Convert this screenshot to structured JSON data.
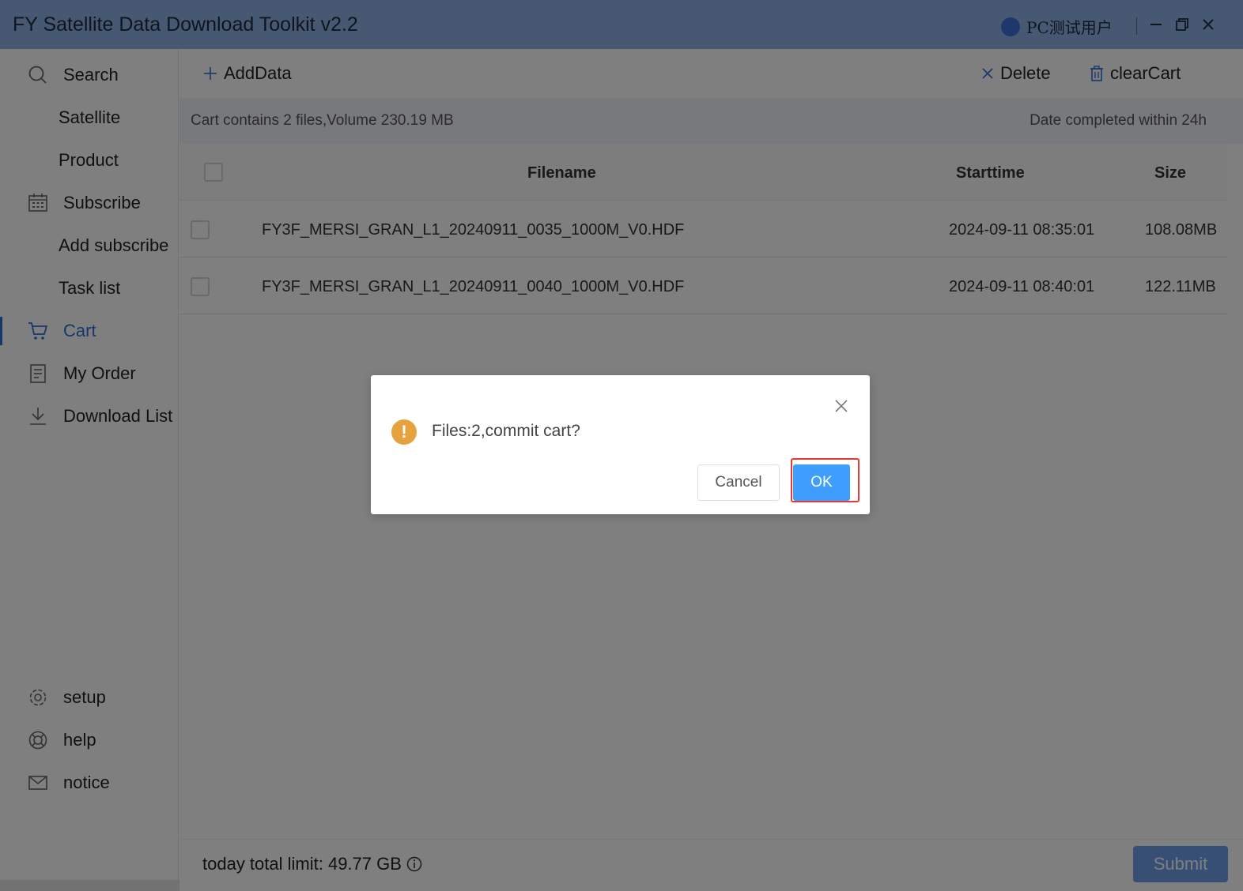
{
  "window": {
    "title": "FY Satellite Data Download Toolkit v2.2",
    "user": "PC测试用户"
  },
  "sidebar": {
    "items": [
      {
        "label": "Search",
        "icon": "search-icon"
      },
      {
        "label": "Satellite"
      },
      {
        "label": "Product"
      },
      {
        "label": "Subscribe",
        "icon": "calendar-icon"
      },
      {
        "label": "Add subscribe"
      },
      {
        "label": "Task list"
      },
      {
        "label": "Cart",
        "icon": "cart-icon",
        "active": true
      },
      {
        "label": "My Order",
        "icon": "document-icon"
      },
      {
        "label": "Download List",
        "icon": "download-icon"
      }
    ],
    "bottom_items": [
      {
        "label": "setup",
        "icon": "gear-icon"
      },
      {
        "label": "help",
        "icon": "help-icon"
      },
      {
        "label": "notice",
        "icon": "mail-icon"
      }
    ]
  },
  "toolbar": {
    "add_label": "AddData",
    "delete_label": "Delete",
    "clear_label": "clearCart"
  },
  "infobar": {
    "summary": "Cart contains 2 files,Volume 230.19 MB",
    "note": "Date completed within 24h"
  },
  "table": {
    "columns": [
      "Filename",
      "Starttime",
      "Size"
    ],
    "rows": [
      {
        "filename": "FY3F_MERSI_GRAN_L1_20240911_0035_1000M_V0.HDF",
        "starttime": "2024-09-11 08:35:01",
        "size": "108.08MB"
      },
      {
        "filename": "FY3F_MERSI_GRAN_L1_20240911_0040_1000M_V0.HDF",
        "starttime": "2024-09-11 08:40:01",
        "size": "122.11MB"
      }
    ]
  },
  "footer": {
    "limit": "today total limit: 49.77 GB",
    "submit_label": "Submit"
  },
  "dialog": {
    "message": "Files:2,commit cart?",
    "cancel_label": "Cancel",
    "ok_label": "OK"
  },
  "colors": {
    "accent": "#2e6fd6",
    "primary_button": "#409eff",
    "warning": "#e6a23c",
    "highlight": "#e53935"
  }
}
